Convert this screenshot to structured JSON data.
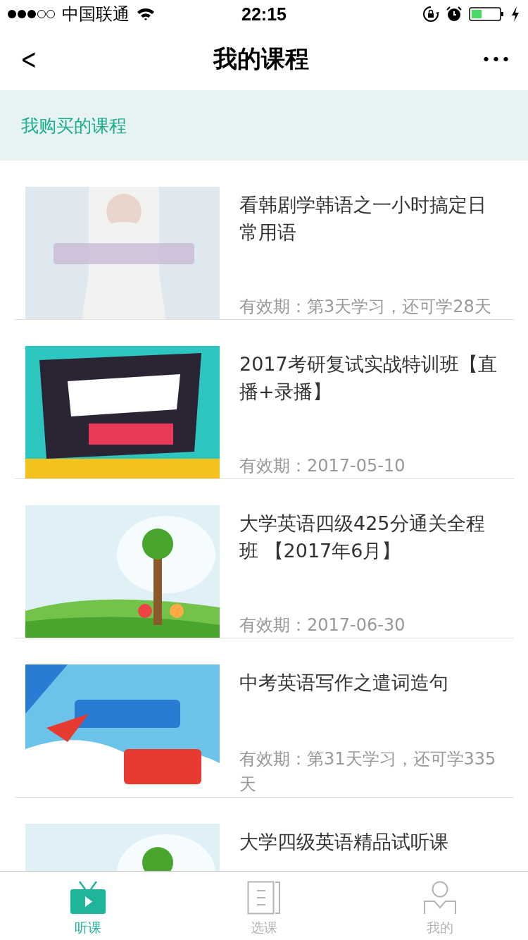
{
  "status_bar": {
    "carrier": "中国联通",
    "time": "22:15"
  },
  "nav": {
    "title": "我的课程",
    "back": "<",
    "more": "•••"
  },
  "section": {
    "title": "我购买的课程"
  },
  "courses": [
    {
      "kind": "picture",
      "title": "看韩剧学韩语之一小时搞定日常用语",
      "validity": "有效期：第3天学习，还可学28天"
    },
    {
      "kind": "picture",
      "title": "2017考研复试实战特训班【直播+录播】",
      "validity": "有效期：2017-05-10"
    },
    {
      "kind": "picture",
      "title": "大学英语四级425分通关全程班 【2017年6月】",
      "validity": "有效期：2017-06-30"
    },
    {
      "kind": "picture",
      "title": "中考英语写作之遣词造句",
      "validity": "有效期：第31天学习，还可学335天"
    },
    {
      "kind": "picture",
      "title": "大学四级英语精品试听课"
    }
  ],
  "tabs": [
    {
      "kind": "tv",
      "label": "听课",
      "selected": true
    },
    {
      "kind": "doc",
      "label": "选课",
      "selected": false
    },
    {
      "kind": "person",
      "label": "我的",
      "selected": false
    }
  ]
}
